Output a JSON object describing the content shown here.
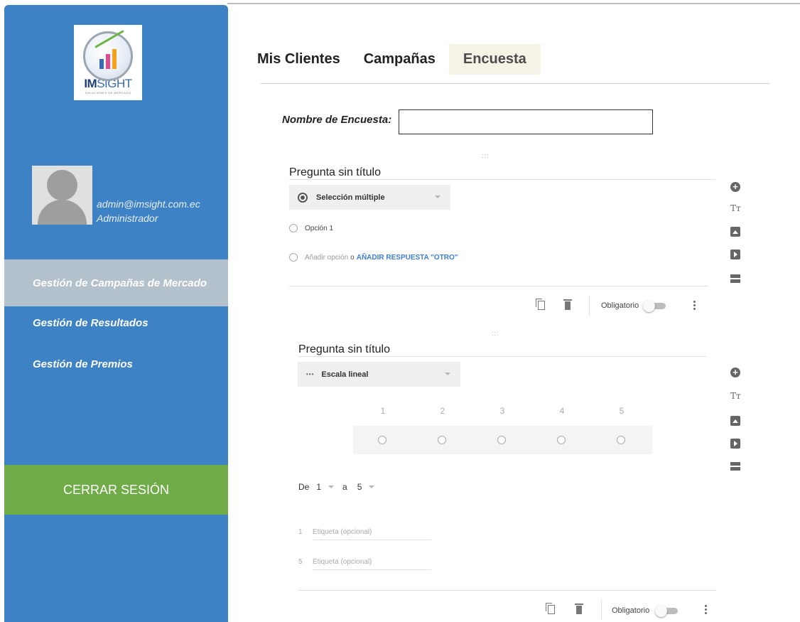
{
  "sidebar": {
    "logo": {
      "brand_bold": "IM",
      "brand_rest": "SIGHT",
      "tagline": "SOLUCIONES DE MERCADO"
    },
    "user": {
      "email": "admin@imsight.com.ec",
      "role": "Administrador"
    },
    "nav": [
      {
        "label": "Gestión de Campañas de Mercado",
        "active": true
      },
      {
        "label": "Gestión de Resultados",
        "active": false
      },
      {
        "label": "Gestión de Premios",
        "active": false
      }
    ],
    "logout_label": "CERRAR SESIÓN"
  },
  "tabs": [
    {
      "label": "Mis Clientes",
      "active": false
    },
    {
      "label": "Campañas",
      "active": false
    },
    {
      "label": "Encuesta",
      "active": true
    }
  ],
  "survey": {
    "name_label": "Nombre de Encuesta:",
    "name_value": ""
  },
  "questions": [
    {
      "title": "Pregunta sin título",
      "type": "Selección múltiple",
      "options": [
        "Opción 1"
      ],
      "add_option": "Añadir opción",
      "or": "o",
      "add_other": "AÑADIR RESPUESTA \"OTRO\"",
      "required_label": "Obligatorio",
      "required": false
    },
    {
      "title": "Pregunta sin título",
      "type": "Escala lineal",
      "scale": [
        "1",
        "2",
        "3",
        "4",
        "5"
      ],
      "from_label": "De",
      "from_value": "1",
      "to_label": "a",
      "to_value": "5",
      "labels": [
        {
          "index": "1",
          "placeholder": "Etiqueta (opcional)"
        },
        {
          "index": "5",
          "placeholder": "Etiqueta (opcional)"
        }
      ],
      "required_label": "Obligatorio",
      "required": false
    }
  ],
  "tools_icons": [
    "add-question-icon",
    "add-title-icon",
    "add-image-icon",
    "add-video-icon",
    "add-section-icon"
  ],
  "colors": {
    "sidebar": "#3e82c6",
    "nav_active": "#b3c1cc",
    "logout": "#6fac47",
    "tab_active_bg": "#f7f2e6",
    "link": "#3f7ed6"
  }
}
